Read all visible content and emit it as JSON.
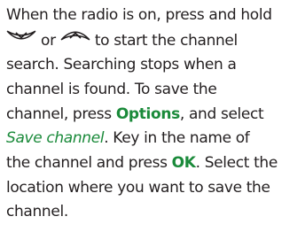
{
  "paragraph": {
    "l1": "When the radio is on, press and hold",
    "l2_mid": " or ",
    "l2_end": " to start the channel",
    "l3": "search. Searching stops when a",
    "l4": "channel is found. To save the",
    "l5_start": "channel, press ",
    "l5_key": "Options",
    "l5_end": ", and select",
    "l6_menu": "Save channel",
    "l6_end": ". Key in the name of",
    "l7_start": "the channel and press ",
    "l7_key": "OK",
    "l7_end": ". Select the",
    "l8": "location where you want to save the",
    "l9": "channel."
  },
  "icons": {
    "scroll_down": "scroll-down-key-icon",
    "scroll_up": "scroll-up-key-icon"
  },
  "colors": {
    "text": "#231f20",
    "highlight": "#1a8a3a"
  }
}
